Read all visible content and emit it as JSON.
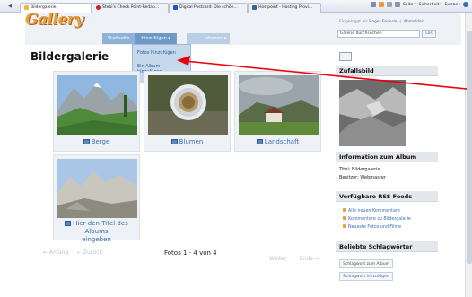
{
  "browser": {
    "nav_left": "◀",
    "tabs": [
      {
        "label": "Bildergalerie",
        "color": "#f2b64a"
      },
      {
        "label": "Stebi's Check Point-Redap...",
        "color": "#cc2222"
      },
      {
        "label": "Digital Postcard: Die schön...",
        "color": "#2255bb"
      },
      {
        "label": "Hostpoint - Hosting Provi...",
        "color": "#336699"
      }
    ],
    "tools": [
      "Seite",
      "Sicherheit",
      "Extras"
    ]
  },
  "header": {
    "logo": "Gallery",
    "login_text": "Eingeloggt als",
    "login_user": "Roger Federle",
    "logout": "Abmelden",
    "search_value": "Galerie durchsuchen",
    "search_button": "Los"
  },
  "nav": {
    "items": [
      "Startseite",
      "Hinzufügen ▾"
    ],
    "ghost": "ationen ▾",
    "dropdown": [
      "Fotos hinzufügen",
      "Ein Album",
      "hinzufügen"
    ]
  },
  "main": {
    "title": "Bildergalerie",
    "albums": [
      {
        "label": "Berge"
      },
      {
        "label": "Blumen"
      },
      {
        "label": "Landschaft"
      },
      {
        "label": "Hier den Titel des Albums",
        "label2": "eingeben"
      }
    ],
    "pager": {
      "first": "⇤ Anfang",
      "prev": "⇠ Zurück",
      "status": "Fotos 1 - 4 von 4",
      "next": "Weiter",
      "last": "Ende ⇥"
    }
  },
  "sidebar": {
    "random": {
      "title": "Zufallsbild"
    },
    "album_info": {
      "title": "Information zum Album",
      "line1": "Titel: Bildergalerie",
      "line2": "Besitzer: Webmaster"
    },
    "rss": {
      "title": "Verfügbare RSS Feeds",
      "links": [
        "Alle neuen Kommentare",
        "Kommentare zu Bildergalerie",
        "Neueste Fotos und Filme"
      ]
    },
    "tags": {
      "title": "Beliebte Schlagwörter",
      "button1": "Schlagwort zum Album",
      "button2": "Schlagwort hinzufügen"
    }
  },
  "colors": {
    "accent": "#3a6fb5",
    "nav": "#8fb3d8",
    "annotation": "#e8000b"
  }
}
